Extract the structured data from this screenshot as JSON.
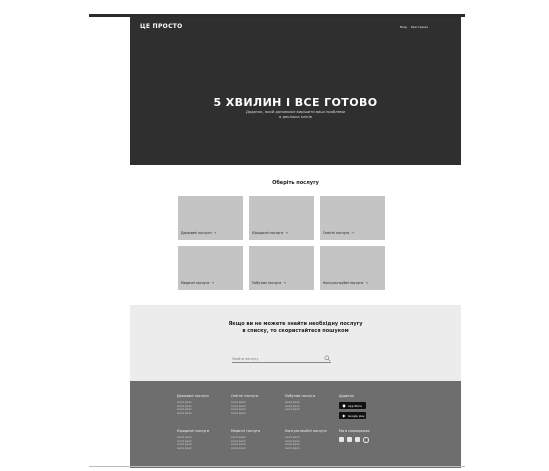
{
  "header": {
    "logo": "ЦЕ ПРОСТО",
    "nav": [
      "Вхід",
      "Реєстрація"
    ]
  },
  "hero": {
    "title": "5 ХВИЛИН І ВСЕ ГОТОВО",
    "subtitle_line1": "Додаток, який допоможе вирішити ваші проблеми",
    "subtitle_line2": "в декілька кліків"
  },
  "services": {
    "title": "Оберіть послугу",
    "arrow": "→",
    "items": [
      {
        "label": "Державні послуги"
      },
      {
        "label": "Юридичні послуги"
      },
      {
        "label": "Освітні послуги"
      },
      {
        "label": "Медичні послуги"
      },
      {
        "label": "Побутові послуги"
      },
      {
        "label": "Консультаційні послуги"
      }
    ]
  },
  "search": {
    "title_line1": "Якщо ви не можете знайти необхідну послугу",
    "title_line2": "в списку, то скористайтеся пошуком",
    "placeholder": "Знайти послугу"
  },
  "footer": {
    "columns": [
      {
        "title": "Державні послуги",
        "items": [
          "Lorem ipsum",
          "Lorem ipsum",
          "Lorem ipsum",
          "Lorem ipsum"
        ]
      },
      {
        "title": "Освітні послуги",
        "items": [
          "Lorem ipsum",
          "Lorem ipsum",
          "Lorem ipsum",
          "Lorem ipsum"
        ]
      },
      {
        "title": "Побутові послуги",
        "items": [
          "Lorem ipsum",
          "Lorem ipsum",
          "Lorem ipsum"
        ]
      },
      {
        "title": "Юридичні послуги",
        "items": [
          "Lorem ipsum",
          "Lorem ipsum",
          "Lorem ipsum",
          "Lorem ipsum"
        ]
      },
      {
        "title": "Медичні послуги",
        "items": [
          "Lorem ipsum",
          "Lorem ipsum",
          "Lorem ipsum",
          "Lorem ipsum"
        ]
      },
      {
        "title": "Консультаційні послуги",
        "items": [
          "Lorem ipsum",
          "Lorem ipsum",
          "Lorem ipsum",
          "Lorem ipsum"
        ]
      }
    ],
    "app_title": "Додаток",
    "app_store": "App Store",
    "google_play": "Google play",
    "social_title": "Ми в соцмережах",
    "social_icons": [
      "facebook-icon",
      "twitter-icon",
      "youtube-icon",
      "instagram-icon"
    ]
  }
}
